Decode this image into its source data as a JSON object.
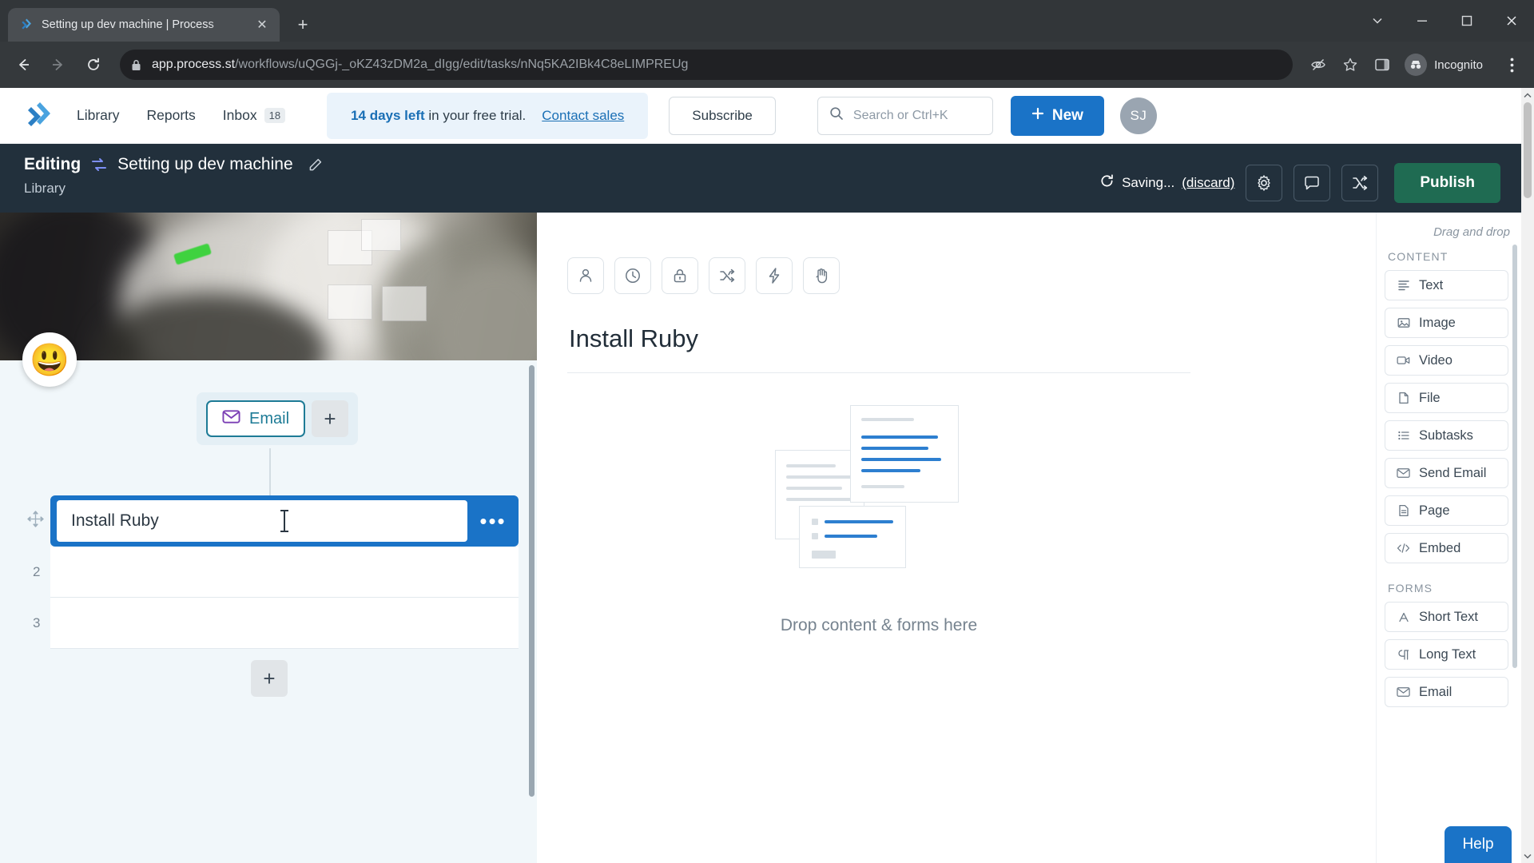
{
  "browser": {
    "tab": {
      "title": "Setting up dev machine | Process",
      "favicon": "process-st-logo-icon",
      "close_label": "✕"
    },
    "new_tab_label": "+",
    "window_controls": {
      "minimize": "minimize-icon",
      "maximize": "maximize-icon",
      "close": "close-icon",
      "dropdown": "tab-search-icon"
    },
    "url": {
      "domain": "app.process.st",
      "path": "/workflows/uQGGj-_oKZ43zDM2a_dIgg/edit/tasks/nNq5KA2IBk4C8eLIMPREUg"
    },
    "profile_label": "Incognito",
    "nav": {
      "back": "back-arrow-icon",
      "forward": "forward-arrow-icon",
      "reload": "reload-icon"
    },
    "toolbar_icons": {
      "third_party_cookies": "eye-slash-icon",
      "bookmark": "star-icon",
      "side_panel": "side-panel-icon",
      "menu": "kebab-menu-icon"
    }
  },
  "appnav": {
    "brand": "process-st-logo",
    "links": [
      {
        "label": "Library",
        "name": "nav-link-library"
      },
      {
        "label": "Reports",
        "name": "nav-link-reports"
      },
      {
        "label": "Inbox",
        "name": "nav-link-inbox",
        "badge": "18"
      }
    ],
    "trial": {
      "bold": "14 days left",
      "rest": " in your free trial.",
      "cta": "Contact sales"
    },
    "subscribe_label": "Subscribe",
    "search": {
      "placeholder": "Search or Ctrl+K",
      "value": "",
      "icon": "search-icon"
    },
    "new_button": {
      "label": "New",
      "icon": "plus-icon"
    },
    "avatar_initials": "SJ"
  },
  "edit_header": {
    "editing_label": "Editing",
    "workflow_icon": "workflow-swap-icon",
    "workflow_name": "Setting up dev machine",
    "rename_icon": "pencil-edit-icon",
    "breadcrumb": "Library",
    "saving_text": "Saving...",
    "discard_label": "(discard)",
    "saving_icon": "sync-spinner-icon",
    "icon_buttons": [
      {
        "name": "workflow-settings-button",
        "icon": "gear-icon"
      },
      {
        "name": "comments-button",
        "icon": "comment-bubble-icon"
      },
      {
        "name": "workflow-run-link-button",
        "icon": "shuffle-icon"
      }
    ],
    "publish_label": "Publish"
  },
  "left_panel": {
    "cover_photo_alt": "whiteboard-workshop-photo",
    "emoji": "😃",
    "email_chip": {
      "label": "Email",
      "icon": "envelope-icon"
    },
    "add_step_label": "+",
    "tasks": [
      {
        "number": "",
        "title": "Install Ruby",
        "active": true,
        "more_label": "•••"
      },
      {
        "number": "2",
        "title": "",
        "active": false
      },
      {
        "number": "3",
        "title": "",
        "active": false
      }
    ],
    "add_task_label": "+",
    "drag_handle_icon": "move-handle-icon"
  },
  "main_panel": {
    "toolbar": [
      {
        "name": "assign-task-button",
        "icon": "person-icon"
      },
      {
        "name": "due-date-button",
        "icon": "clock-icon"
      },
      {
        "name": "permissions-button",
        "icon": "lock-icon"
      },
      {
        "name": "conditional-logic-button",
        "icon": "shuffle-icon"
      },
      {
        "name": "automation-button",
        "icon": "lightning-bolt-icon"
      },
      {
        "name": "stop-task-button",
        "icon": "hand-stop-icon"
      }
    ],
    "task_title": "Install Ruby",
    "dropzone_text": "Drop content & forms here"
  },
  "right_panel": {
    "drag_hint": "Drag and drop",
    "sections": [
      {
        "label": "CONTENT",
        "items": [
          {
            "label": "Text",
            "icon": "text-icon",
            "name": "panel-item-text"
          },
          {
            "label": "Image",
            "icon": "image-icon",
            "name": "panel-item-image"
          },
          {
            "label": "Video",
            "icon": "video-icon",
            "name": "panel-item-video"
          },
          {
            "label": "File",
            "icon": "file-icon",
            "name": "panel-item-file"
          },
          {
            "label": "Subtasks",
            "icon": "list-icon",
            "name": "panel-item-subtasks"
          },
          {
            "label": "Send Email",
            "icon": "envelope-icon",
            "name": "panel-item-send-email"
          },
          {
            "label": "Page",
            "icon": "page-icon",
            "name": "panel-item-page"
          },
          {
            "label": "Embed",
            "icon": "code-embed-icon",
            "name": "panel-item-embed"
          }
        ]
      },
      {
        "label": "FORMS",
        "items": [
          {
            "label": "Short Text",
            "icon": "short-text-icon",
            "name": "panel-item-short-text"
          },
          {
            "label": "Long Text",
            "icon": "long-text-icon",
            "name": "panel-item-long-text"
          },
          {
            "label": "Email",
            "icon": "envelope-icon",
            "name": "panel-item-form-email"
          }
        ]
      }
    ]
  },
  "help_button_label": "Help",
  "colors": {
    "accent_blue": "#1a73c7",
    "publish_green": "#1f6b52",
    "header_dark": "#22303c",
    "teal": "#1d7b96",
    "purple": "#7b3fb5"
  }
}
